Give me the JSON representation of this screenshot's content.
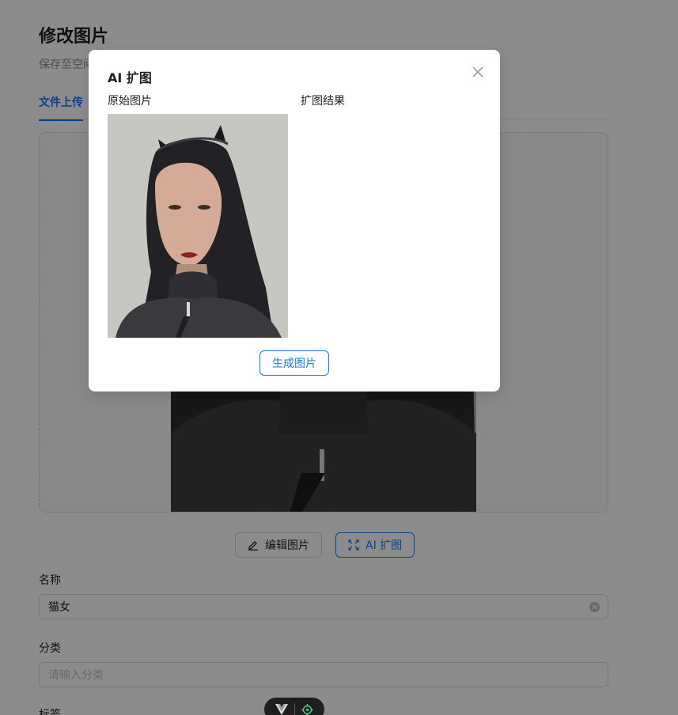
{
  "page": {
    "title": "修改图片",
    "subtitle": "保存至空间",
    "active_tab": "文件上传"
  },
  "actions": {
    "edit_label": "编辑图片",
    "ai_label": "AI 扩图"
  },
  "form": {
    "name_label": "名称",
    "name_value": "猫女",
    "category_label": "分类",
    "category_placeholder": "请输入分类",
    "tags_label": "标签"
  },
  "modal": {
    "title": "AI 扩图",
    "original_label": "原始图片",
    "result_label": "扩图结果",
    "generate_label": "生成图片"
  },
  "icons": {
    "close": "close-icon",
    "edit": "edit-icon",
    "expand": "expand-icon",
    "clear": "clear-icon",
    "vue_devtools": "vue-logo-icon",
    "inspector": "crosshair-icon"
  },
  "colors": {
    "primary": "#1677ff",
    "mask": "rgba(0,0,0,0.45)",
    "devtools_green": "#42d392"
  }
}
